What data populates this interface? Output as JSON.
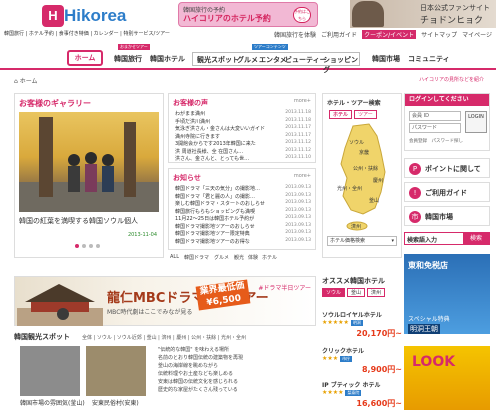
{
  "brand": {
    "mark": "H",
    "name": "Hikorea",
    "accent": "#d62a6a",
    "logo_blue": "#2d7dc9"
  },
  "promo": {
    "line1": "韓国旅行の予約",
    "line2": "ハイコリアのホテル予約",
    "badge": "予約はこちら"
  },
  "celeb": {
    "line1": "日本公式ファンサイト",
    "line2": "チョドンヒョク"
  },
  "subnav": {
    "text": "韓国旅行 | ホテル予約 | 食事付き特価 | カレンダー | 特別サービス/ツアー"
  },
  "utilnav": [
    "韓国旅行を体験",
    "ご利用ガイド",
    "クーポン/イベント",
    "サイトマップ",
    "マイページ"
  ],
  "mainnav": {
    "home": "ホーム",
    "tour": "韓国旅行",
    "tour_tag": "おまかせツアー",
    "hotel": "韓国ホテル",
    "group_tag": "ツアーコンテンツ",
    "group": [
      "観光スポット",
      "グルメ",
      "エンタメ",
      "ビューティー",
      "ショッピング"
    ],
    "market": "韓国市場",
    "community": "コミュニティ"
  },
  "breadcrumb": "ホーム",
  "breadcrumb_right": "ハイコリアの見所などを紹介",
  "gallery": {
    "title": "お客様のギャラリー",
    "caption": "韓国の紅葉を満喫する韓国ソウル個人",
    "date": "2013-11-04"
  },
  "voices": {
    "title": "お客様の声",
    "more": "more+",
    "items": [
      {
        "t": "わがまま満州",
        "d": "2013.11.18"
      },
      {
        "t": "手頃だ洪川満州",
        "d": "2013.11.18"
      },
      {
        "t": "気泳ぎ洪さん・金さんは大変いいガイド",
        "d": "2013.11.17"
      },
      {
        "t": "満州寺院に行きます",
        "d": "2013.11.17"
      },
      {
        "t": "3開館会からです2013年韓国に来た",
        "d": "2013.11.12"
      },
      {
        "t": "洪 周道社長様、全 在国さん…",
        "d": "2013.11.12"
      },
      {
        "t": "洪さん、金さんと、とっても世…",
        "d": "2013.11.10"
      },
      {
        "t": "やっぱり ハイコリアのかがまま旅行",
        "d": "2013.11.08"
      }
    ]
  },
  "news": {
    "title": "お知らせ",
    "more": "more+",
    "items": [
      {
        "t": "韓国ドラマ「三天の気分」の撮影地…",
        "d": "2013.09.13"
      },
      {
        "t": "韓国ドラマ「君と麗の人」の撮影…",
        "d": "2013.09.13"
      },
      {
        "t": "楽しむ韓国ドラマ・スタートのおしらせ",
        "d": "2013.09.13"
      },
      {
        "t": "韓国旅行もらもショッピングも満喫",
        "d": "2013.09.13"
      },
      {
        "t": "11月22～25日は韓国ホテル予約が",
        "d": "2013.09.13"
      },
      {
        "t": "韓国ドラマ撮影地ツアーのおしらせ",
        "d": "2013.09.13"
      },
      {
        "t": "韓国ドラマ撮影地ツアー限定特典",
        "d": "2013.09.13"
      },
      {
        "t": "韓国ドラマ撮影地ツアーのお得な",
        "d": "2013.09.13"
      }
    ]
  },
  "list_tabs": [
    "ALL",
    "韓国ドラマ",
    "グルメ",
    "観光",
    "体験",
    "ホテル"
  ],
  "map": {
    "title": "ホテル・ツアー検索",
    "tab_on": "ホテル",
    "tab_off": "ツアー",
    "regions": [
      "ソウル",
      "京畿",
      "公州・扶餘",
      "慶州",
      "光州・全州",
      "釜山",
      "済州"
    ],
    "select_label": "ホテル価格検索"
  },
  "login": {
    "title": "ログインしてください",
    "id_placeholder": "会員 ID",
    "pw_placeholder": "パスワード",
    "button": "LOGIN",
    "links": "会員登録　パスワード探し"
  },
  "side_buttons": [
    {
      "icon": "P",
      "label": "ポイントに関して"
    },
    {
      "icon": "!",
      "label": "ご利用ガイド"
    },
    {
      "icon": "市",
      "label": "韓国市場"
    }
  ],
  "search": {
    "label": "検索語入力",
    "button": "検索"
  },
  "ad_side": {
    "line1": "東和免税店",
    "line2": "スペシャル特典",
    "line3": "明洞王朝",
    "ad2": "LOOK"
  },
  "banner": {
    "title": "龍仁MBCドラマ半日ツアー",
    "sub": "MBC時代劇はここでみなが見る",
    "price_label": "業界最低価",
    "price": "¥6,500",
    "right": "#ドラマ半日ツアー"
  },
  "spots": {
    "title": "韓国観光スポット",
    "tabs": "全体 | ソウル | ソウル近郊 | 釜山 | 済州 | 慶州 | 公州・扶餘 | 光州・全州",
    "caption1": "韓国市場の雰囲気(釜山)",
    "caption2": "安東民俗村(安東)",
    "paragraph": [
      "\"伝統的な韓国\" を味わえる場所",
      "名前のとおり韓国伝統の建築物を再現",
      "釜山の海岸線を眺めながら",
      "伝統料理やお土産なども楽しめる",
      "安東は韓国の伝統文化を感じられる",
      "歴史的な家屋がたくさん残っている"
    ]
  },
  "hotels": {
    "title": "オススメ韓国ホテル",
    "tabs": [
      "ソウル",
      "釜山",
      "済州"
    ],
    "items": [
      {
        "name": "ソウルロイヤルホテル",
        "stars": "★★★★★",
        "price": "20,170円~",
        "badge": "明洞"
      },
      {
        "name": "クリックホテル",
        "stars": "★★★",
        "price": "8,900円~",
        "badge": "市庁"
      },
      {
        "name": "IP ブティック ホテル",
        "stars": "★★★★",
        "price": "16,600円~",
        "badge": "梨泰院"
      }
    ]
  }
}
